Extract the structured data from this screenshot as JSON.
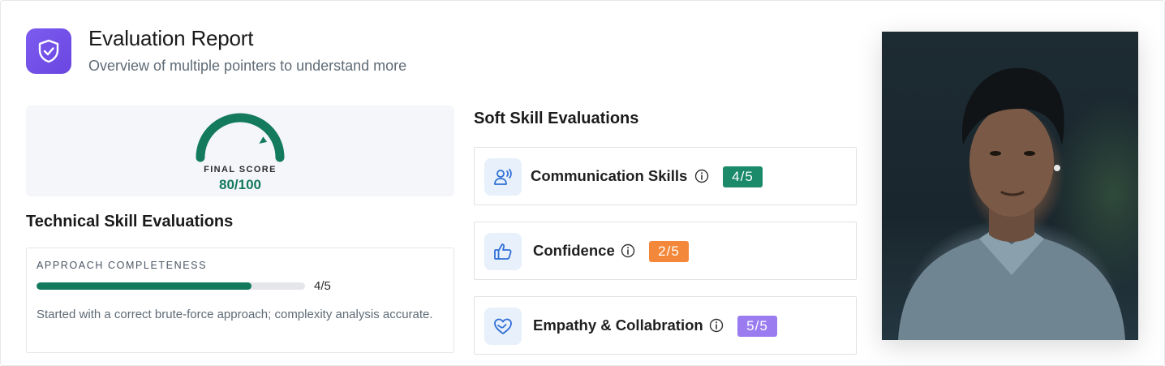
{
  "header": {
    "title": "Evaluation Report",
    "subtitle": "Overview of multiple pointers to understand more",
    "icon": "shield-check-icon"
  },
  "final_score": {
    "label": "FINAL SCORE",
    "value_text": "80/100",
    "value": 80,
    "max": 100,
    "color": "#137a5d"
  },
  "technical": {
    "heading": "Technical Skill Evaluations",
    "items": [
      {
        "label": "APPROACH COMPLETENESS",
        "score_text": "4/5",
        "score": 4,
        "max": 5,
        "description": "Started with a correct brute-force approach; complexity analysis accurate."
      }
    ]
  },
  "soft": {
    "heading": "Soft Skill Evaluations",
    "items": [
      {
        "name": "Communication Skills",
        "score": "4/5",
        "icon": "speaking-person-icon",
        "badge_color": "#1a8a6a"
      },
      {
        "name": "Confidence",
        "score": "2/5",
        "icon": "thumbs-up-icon",
        "badge_color": "#f4883a"
      },
      {
        "name": "Empathy & Collabration",
        "score": "5/5",
        "icon": "heart-hand-icon",
        "badge_color": "#9a7cf0"
      }
    ]
  },
  "colors": {
    "accent": "#6a46e0",
    "success": "#137a5d",
    "soft_icon_bg": "#e7f0fb",
    "soft_icon_stroke": "#2f6fd6"
  }
}
